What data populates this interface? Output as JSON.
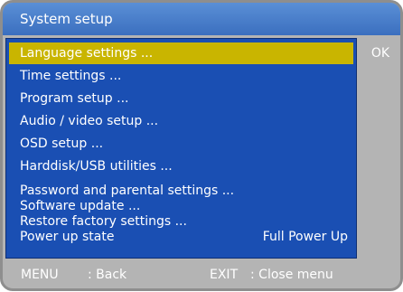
{
  "window": {
    "title": "System setup"
  },
  "menu": {
    "items": [
      {
        "label": "Language settings ..."
      },
      {
        "label": "Time settings ..."
      },
      {
        "label": "Program setup ..."
      },
      {
        "label": "Audio / video setup ..."
      },
      {
        "label": "OSD setup ..."
      },
      {
        "label": "Harddisk/USB utilities ..."
      },
      {
        "label": "Password  and  parental settings ..."
      },
      {
        "label": "Software update ..."
      },
      {
        "label": "Restore factory settings ..."
      },
      {
        "label": "Power up state",
        "value": "Full Power Up"
      }
    ],
    "selected_index": 0
  },
  "side": {
    "ok_label": "OK"
  },
  "footer": {
    "menu_key": "MENU",
    "menu_action": ": Back",
    "exit_key": "EXIT",
    "exit_action": ": Close menu"
  },
  "colors": {
    "title_bar": "#3b6fbf",
    "panel": "#1a4fb3",
    "selection": "#c9b500",
    "frame": "#b4b4b4"
  }
}
